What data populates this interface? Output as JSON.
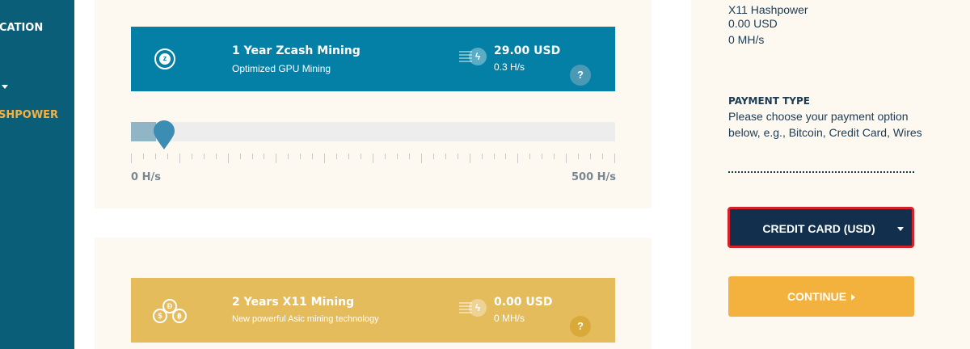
{
  "sidebar": {
    "items": [
      {
        "label": "CATION"
      },
      {
        "label": "SHPOWER"
      }
    ]
  },
  "products": [
    {
      "title": "1 Year Zcash Mining",
      "subtitle": "Optimized GPU Mining",
      "price": "29.00 USD",
      "rate": "0.3 H/s",
      "help": "?",
      "coin_glyph": "z",
      "color": "#0480a6"
    },
    {
      "title": "2 Years X11 Mining",
      "subtitle": "New powerful Asic mining technology",
      "price": "0.00 USD",
      "rate": "0 MH/s",
      "help": "?",
      "color": "#e5bc5c"
    }
  ],
  "slider": {
    "min_label": "0 H/s",
    "max_label": "500 H/s",
    "value_fraction": 0.045
  },
  "summary": {
    "name": "X11 Hashpower",
    "price": "0.00 USD",
    "rate": "0 MH/s"
  },
  "payment": {
    "heading": "PAYMENT TYPE",
    "description": "Please choose your payment option below, e.g., Bitcoin, Credit Card, Wires",
    "selected_method": "CREDIT CARD (USD)"
  },
  "continue_label": "CONTINUE",
  "colors": {
    "sidebar": "#0b5e78",
    "accent_gold": "#f3b13d",
    "navy": "#12304e",
    "selection_outline": "#d2232a"
  }
}
